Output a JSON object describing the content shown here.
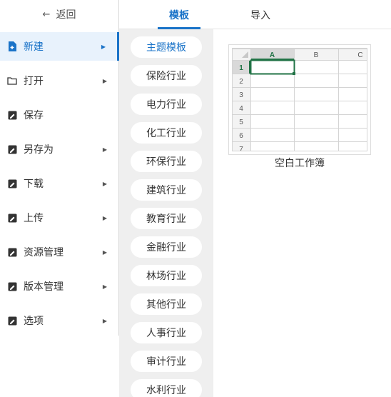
{
  "back_label": "返回",
  "menu": [
    {
      "label": "新建",
      "icon": "file-plus-icon",
      "has_arrow": true,
      "active": true
    },
    {
      "label": "打开",
      "icon": "folder-icon",
      "has_arrow": true,
      "active": false
    },
    {
      "label": "保存",
      "icon": "save-icon",
      "has_arrow": false,
      "active": false
    },
    {
      "label": "另存为",
      "icon": "save-icon",
      "has_arrow": true,
      "active": false
    },
    {
      "label": "下载",
      "icon": "save-icon",
      "has_arrow": true,
      "active": false
    },
    {
      "label": "上传",
      "icon": "save-icon",
      "has_arrow": true,
      "active": false
    },
    {
      "label": "资源管理",
      "icon": "save-icon",
      "has_arrow": true,
      "active": false
    },
    {
      "label": "版本管理",
      "icon": "save-icon",
      "has_arrow": true,
      "active": false
    },
    {
      "label": "选项",
      "icon": "save-icon",
      "has_arrow": true,
      "active": false
    }
  ],
  "tabs": [
    {
      "label": "模板",
      "active": true
    },
    {
      "label": "导入",
      "active": false
    }
  ],
  "categories": [
    {
      "label": "主题模板",
      "active": true
    },
    {
      "label": "保险行业",
      "active": false
    },
    {
      "label": "电力行业",
      "active": false
    },
    {
      "label": "化工行业",
      "active": false
    },
    {
      "label": "环保行业",
      "active": false
    },
    {
      "label": "建筑行业",
      "active": false
    },
    {
      "label": "教育行业",
      "active": false
    },
    {
      "label": "金融行业",
      "active": false
    },
    {
      "label": "林场行业",
      "active": false
    },
    {
      "label": "其他行业",
      "active": false
    },
    {
      "label": "人事行业",
      "active": false
    },
    {
      "label": "审计行业",
      "active": false
    },
    {
      "label": "水利行业",
      "active": false
    }
  ],
  "template": {
    "name": "空白工作簿",
    "columns": [
      "A",
      "B",
      "C"
    ],
    "rows": [
      "1",
      "2",
      "3",
      "4",
      "5",
      "6",
      "7"
    ]
  },
  "colors": {
    "accent": "#1a73c8",
    "active_bg": "#e8f2fc",
    "category_bg": "#efefef",
    "sheet_green": "#217346"
  }
}
